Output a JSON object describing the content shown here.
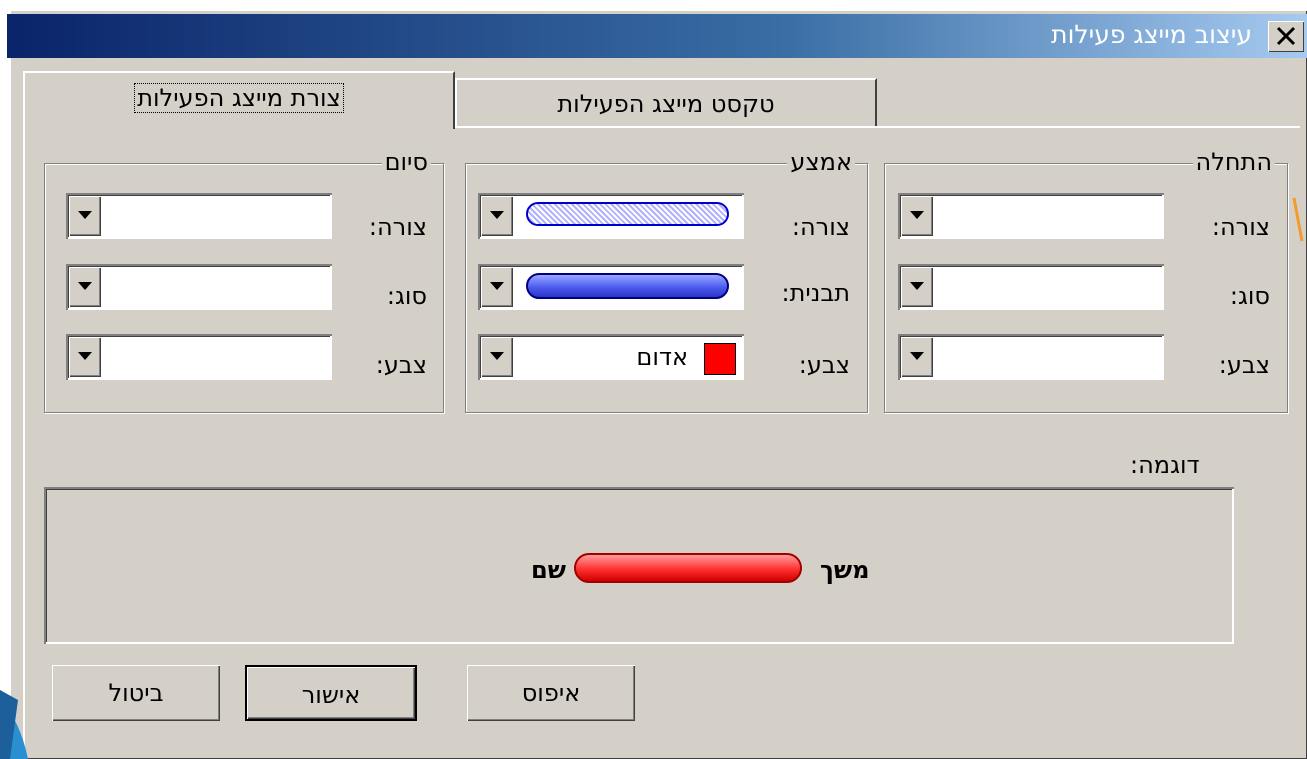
{
  "window": {
    "title": "עיצוב מייצג פעילות"
  },
  "tabs": [
    {
      "label": "צורת מייצג הפעילות",
      "selected": true
    },
    {
      "label": "טקסט מייצג הפעילות",
      "selected": false
    }
  ],
  "groups": {
    "start": {
      "title": "התחלה",
      "rows": [
        {
          "label": "צורה:",
          "value": ""
        },
        {
          "label": "סוג:",
          "value": ""
        },
        {
          "label": "צבע:",
          "value": ""
        }
      ]
    },
    "middle": {
      "title": "אמצע",
      "rows": [
        {
          "label": "צורה:",
          "value": ""
        },
        {
          "label": "תבנית:",
          "value": ""
        },
        {
          "label": "צבע:",
          "value": "אדום"
        }
      ]
    },
    "end": {
      "title": "סיום",
      "rows": [
        {
          "label": "צורה:",
          "value": ""
        },
        {
          "label": "סוג:",
          "value": ""
        },
        {
          "label": "צבע:",
          "value": ""
        }
      ]
    }
  },
  "sample": {
    "label": "דוגמה:",
    "start_text": "משך",
    "end_text": "שם",
    "bar_color": "#ff3030"
  },
  "buttons": {
    "reset": "איפוס",
    "ok": "אישור",
    "cancel": "ביטול"
  },
  "colors": {
    "dialog_bg": "#d4d0c8",
    "title_gradient_start": "#0a246a",
    "title_gradient_end": "#a6caf0",
    "middle_bar": "#4c5cf0",
    "swatch": "#ff0000"
  }
}
